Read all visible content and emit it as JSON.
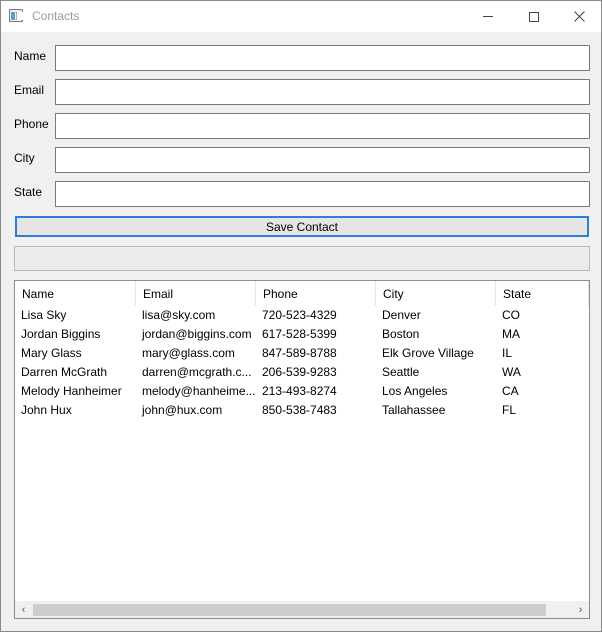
{
  "window": {
    "title": "Contacts",
    "icon": "app-window-icon"
  },
  "form": {
    "name_label": "Name",
    "email_label": "Email",
    "phone_label": "Phone",
    "city_label": "City",
    "state_label": "State",
    "name_value": "",
    "email_value": "",
    "phone_value": "",
    "city_value": "",
    "state_value": ""
  },
  "save_button": {
    "label": "Save Contact"
  },
  "status": {
    "text": ""
  },
  "contacts": {
    "columns": [
      "Name",
      "Email",
      "Phone",
      "City",
      "State"
    ],
    "rows": [
      [
        "Lisa Sky",
        "lisa@sky.com",
        "720-523-4329",
        "Denver",
        "CO"
      ],
      [
        "Jordan Biggins",
        "jordan@biggins.com",
        "617-528-5399",
        "Boston",
        "MA"
      ],
      [
        "Mary Glass",
        "mary@glass.com",
        "847-589-8788",
        "Elk Grove Village",
        "IL"
      ],
      [
        "Darren McGrath",
        "darren@mcgrath.c...",
        "206-539-9283",
        "Seattle",
        "WA"
      ],
      [
        "Melody Hanheimer",
        "melody@hanheime...",
        "213-493-8274",
        "Los Angeles",
        "CA"
      ],
      [
        "John Hux",
        "john@hux.com",
        "850-538-7483",
        "Tallahassee",
        "FL"
      ]
    ]
  },
  "scrollbar": {
    "left_arrow": "‹",
    "right_arrow": "›"
  }
}
